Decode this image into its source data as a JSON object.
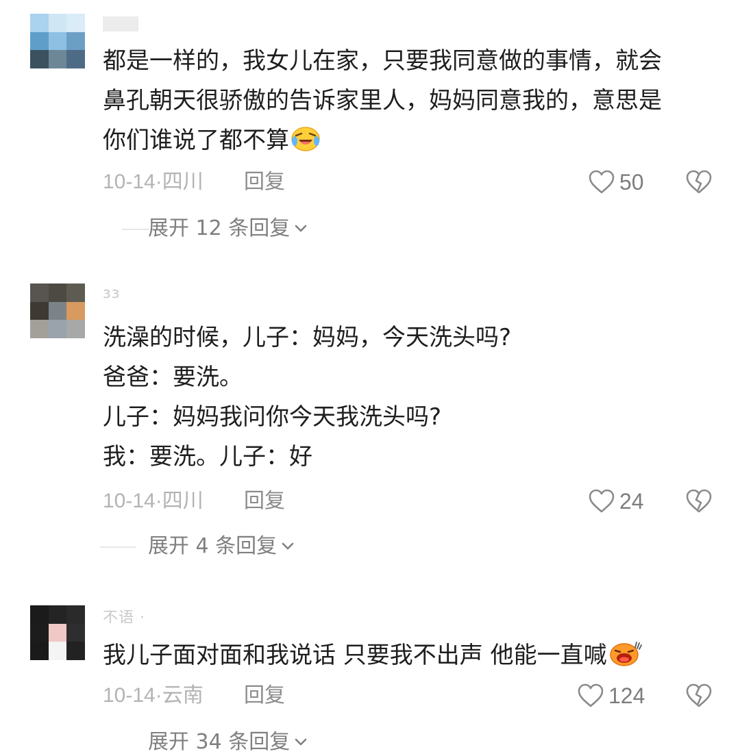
{
  "comments": [
    {
      "username": "",
      "text_lines": [
        "都是一样的，我女儿在家，只要我同意做的事情，就会",
        "鼻孔朝天很骄傲的告诉家里人，妈妈同意我的，意思是",
        "你们谁说了都不算"
      ],
      "emoji_icon": "crying-laughing-emoji-icon",
      "date": "10-14·",
      "location": "四川",
      "reply_label": "回复",
      "likes": "50",
      "expand_label": "展开 12 条回复",
      "avatar_colors": [
        "#a9d3ee",
        "#cfe6f4",
        "#d9ecf7",
        "#5f9ec9",
        "#8ec0e3",
        "#6c9fc4",
        "#3b5160",
        "#6d8797",
        "#4e6b86"
      ]
    },
    {
      "username": "ɜɜ",
      "text_lines": [
        "洗澡的时候，儿子：妈妈，今天洗头吗?",
        "爸爸：要洗。",
        "儿子：妈妈我问你今天我洗头吗?",
        "我：要洗。儿子：好"
      ],
      "emoji_icon": "",
      "date": "10-14·",
      "location": "四川",
      "reply_label": "回复",
      "likes": "24",
      "expand_label": "展开 4 条回复",
      "avatar_colors": [
        "#585450",
        "#4d4a44",
        "#5e5b52",
        "#3e3a33",
        "#7c8388",
        "#d89a5e",
        "#a3a09a",
        "#9aa3ac",
        "#a7a9a9"
      ]
    },
    {
      "username": "不语 ·",
      "text_lines": [
        "我儿子面对面和我说话 只要我不出声 他能一直喊"
      ],
      "emoji_icon": "shouting-emoji-icon",
      "date": "10-14·",
      "location": "云南",
      "reply_label": "回复",
      "likes": "124",
      "expand_label": "展开 34 条回复",
      "avatar_colors": [
        "#1b1b1b",
        "#242424",
        "#2a2a2a",
        "#1c1c1c",
        "#f0c9c6",
        "#2e2e2e",
        "#1a1a1a",
        "#f4f4f4",
        "#222222"
      ]
    }
  ],
  "icons": {
    "like": "heart-outline-icon",
    "dislike": "broken-heart-icon",
    "expand": "chevron-down-icon"
  },
  "colors": {
    "text": "#1e1e1e",
    "meta": "#b3b3b3",
    "reply": "#8b8b8b",
    "icon": "#8a8a8a"
  }
}
